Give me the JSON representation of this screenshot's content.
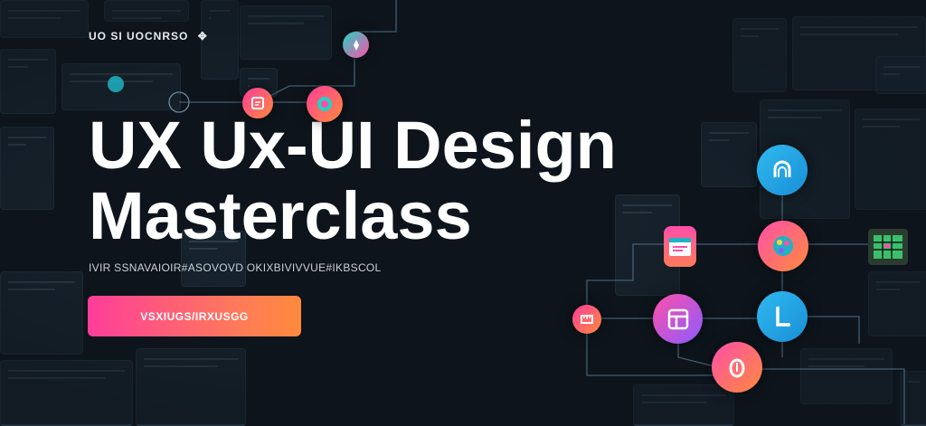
{
  "header": {
    "brand_text": "UO SI UOCNRSO"
  },
  "hero": {
    "title_line1": "UX  Ux-UI Design",
    "title_line2": "Masterclass",
    "tagline": "IVIR SSNAVAIOIR#ASOVOVD OKIXBIVIVVUE#IKBSCOL",
    "cta_label": "VSXIUGS/IRXUSGG"
  },
  "colors": {
    "background": "#0d141b",
    "cta_gradient_start": "#ff3d9a",
    "cta_gradient_end": "#ff8a3d",
    "node_cyan": "#29b6e8",
    "node_pink": "#ff4fa8",
    "node_purple": "#8a5cff"
  },
  "icons": [
    "brand-icon",
    "compass-icon",
    "document-icon",
    "target-icon",
    "arch-icon",
    "palette-icon",
    "browser-window-icon",
    "ruler-icon",
    "layout-icon",
    "mobile-icon",
    "hand-icon",
    "grid-icon"
  ]
}
